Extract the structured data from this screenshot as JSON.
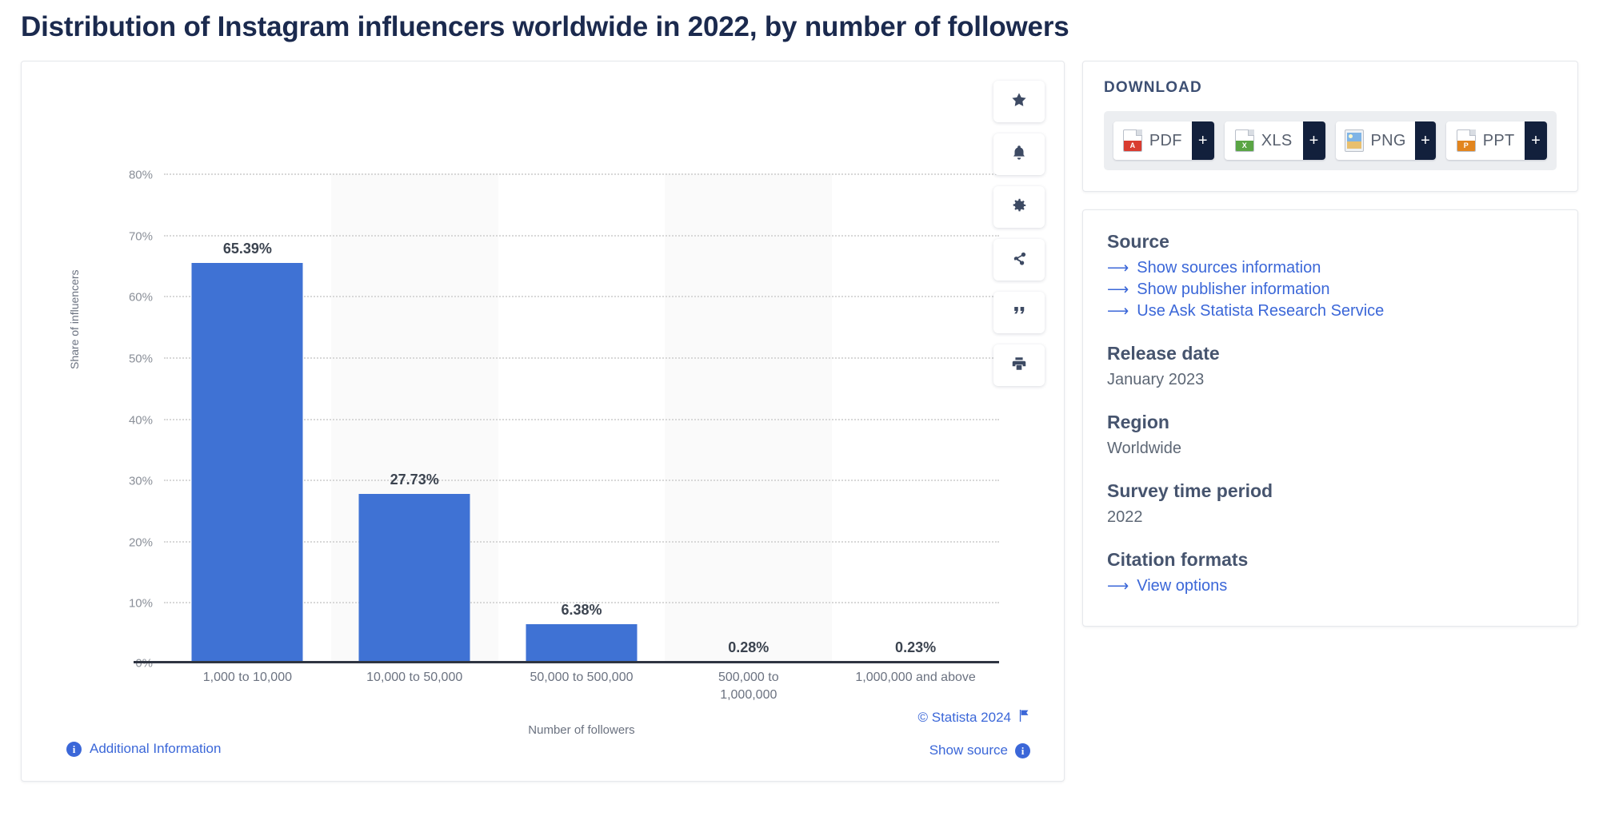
{
  "page_title": "Distribution of Instagram influencers worldwide in 2022, by number of followers",
  "chart_data": {
    "type": "bar",
    "title": "Distribution of Instagram influencers worldwide in 2022, by number of followers",
    "xlabel": "Number of followers",
    "ylabel": "Share of influencers",
    "categories": [
      "1,000 to 10,000",
      "10,000 to 50,000",
      "50,000 to 500,000",
      "500,000 to\n1,000,000",
      "1,000,000 and above"
    ],
    "values": [
      65.39,
      27.73,
      6.38,
      0.28,
      0.23
    ],
    "value_labels": [
      "65.39%",
      "27.73%",
      "6.38%",
      "0.28%",
      "0.23%"
    ],
    "ylim": [
      0,
      80
    ],
    "yticks": [
      0,
      10,
      20,
      30,
      40,
      50,
      60,
      70,
      80
    ],
    "ytick_labels": [
      "0%",
      "10%",
      "20%",
      "30%",
      "40%",
      "50%",
      "60%",
      "70%",
      "80%"
    ],
    "grid": true,
    "legend": false,
    "bar_color": "#3f72d4",
    "band_color": "#fafafa"
  },
  "toolbar": [
    {
      "name": "favorite",
      "icon": "star-icon"
    },
    {
      "name": "alert",
      "icon": "bell-icon"
    },
    {
      "name": "settings",
      "icon": "gear-icon"
    },
    {
      "name": "share",
      "icon": "share-icon"
    },
    {
      "name": "cite",
      "icon": "quote-icon"
    },
    {
      "name": "print",
      "icon": "print-icon"
    }
  ],
  "chart_footer": {
    "copyright": "© Statista 2024",
    "flag_icon": "flag-icon",
    "show_source": "Show source",
    "additional_information": "Additional Information"
  },
  "download": {
    "title": "DOWNLOAD",
    "plus": "+",
    "buttons": [
      {
        "label": "PDF",
        "badge": "A",
        "type": "pdf"
      },
      {
        "label": "XLS",
        "badge": "X",
        "type": "xls"
      },
      {
        "label": "PNG",
        "badge": "",
        "type": "png"
      },
      {
        "label": "PPT",
        "badge": "P",
        "type": "ppt"
      }
    ]
  },
  "info": {
    "source_heading": "Source",
    "source_links": [
      "Show sources information",
      "Show publisher information",
      "Use Ask Statista Research Service"
    ],
    "release_date_heading": "Release date",
    "release_date": "January 2023",
    "region_heading": "Region",
    "region": "Worldwide",
    "survey_heading": "Survey time period",
    "survey": "2022",
    "citation_heading": "Citation formats",
    "citation_link": "View options"
  }
}
